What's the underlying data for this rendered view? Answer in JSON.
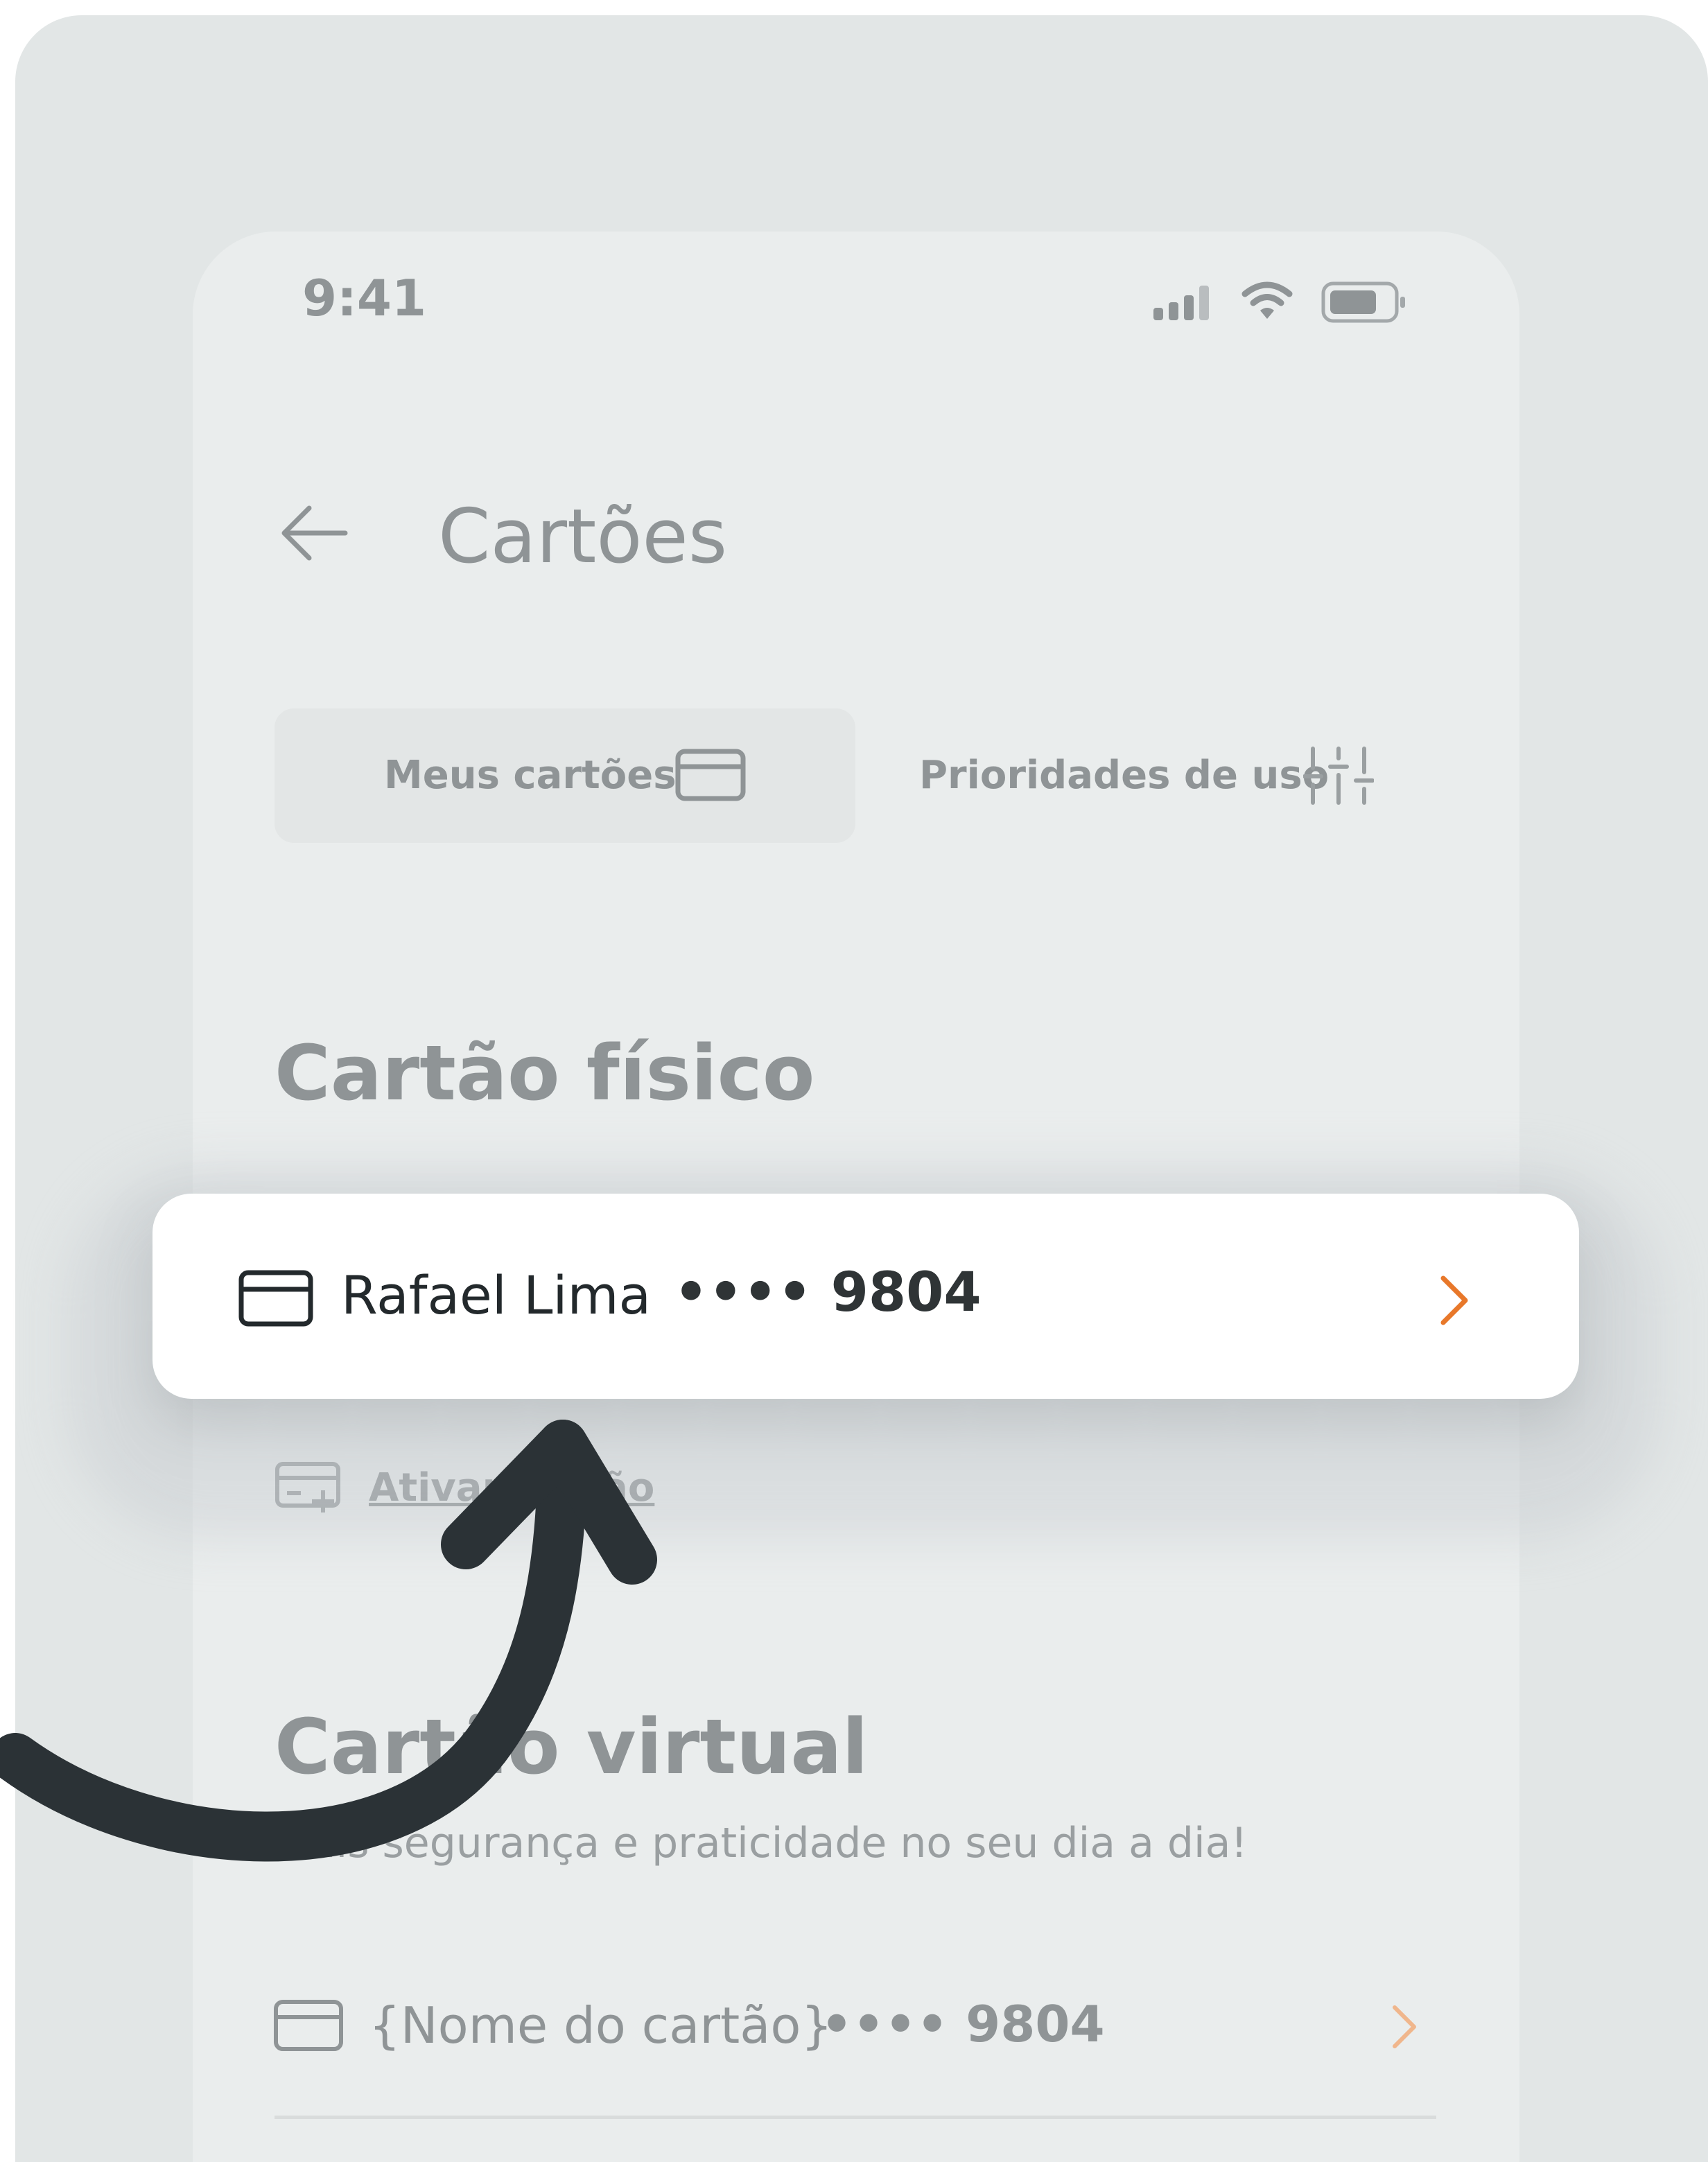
{
  "status_bar": {
    "time": "9:41",
    "icons": [
      "cellular-signal-icon",
      "wifi-icon",
      "battery-icon"
    ]
  },
  "header": {
    "title": "Cartões",
    "back_icon": "arrow-left-icon"
  },
  "segments": {
    "my_cards_label": "Meus cartões",
    "my_cards_icon": "credit-card-icon",
    "priorities_label": "Prioridades de uso",
    "priorities_icon": "sliders-icon"
  },
  "physical_card_section": {
    "title": "Cartão físico",
    "card": {
      "holder_name": "Rafael Lima",
      "masked_number": "•••• 9804",
      "chevron_color": "#e8782a"
    },
    "activate_link": "Ativar cartão"
  },
  "virtual_card_section": {
    "title": "Cartão virtual",
    "subtitle": "Mais segurança e praticidade no seu dia a dia!",
    "card": {
      "name_placeholder": "{Nome do cartão}",
      "masked_number": "•••• 9804",
      "chevron_color": "#f0b68c"
    }
  },
  "colors": {
    "background": "#e2e6e6",
    "phone_surface": "#eaeded",
    "highlight_card": "#ffffff",
    "arrow": "#2b3236",
    "accent_orange": "#e8782a"
  }
}
